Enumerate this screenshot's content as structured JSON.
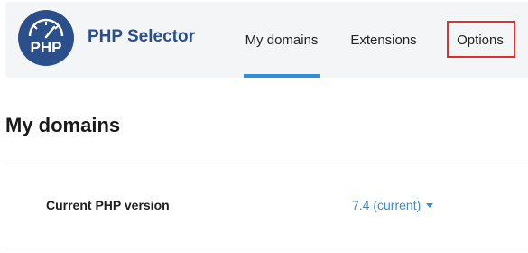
{
  "app": {
    "title": "PHP Selector",
    "logo_text": "PHP",
    "logo_icon": "php-gauge-logo",
    "brand_color": "#2a4f8a",
    "accent_color": "#2f8fdc",
    "highlight_color": "#e0302d"
  },
  "nav": {
    "tabs": [
      {
        "label": "My domains",
        "active": true
      },
      {
        "label": "Extensions",
        "active": false
      },
      {
        "label": "Options",
        "active": false,
        "highlighted": true
      }
    ]
  },
  "main": {
    "title": "My domains",
    "settings": [
      {
        "label": "Current PHP version",
        "value": "7.4 (current)",
        "icon": "caret-down-icon"
      }
    ]
  }
}
